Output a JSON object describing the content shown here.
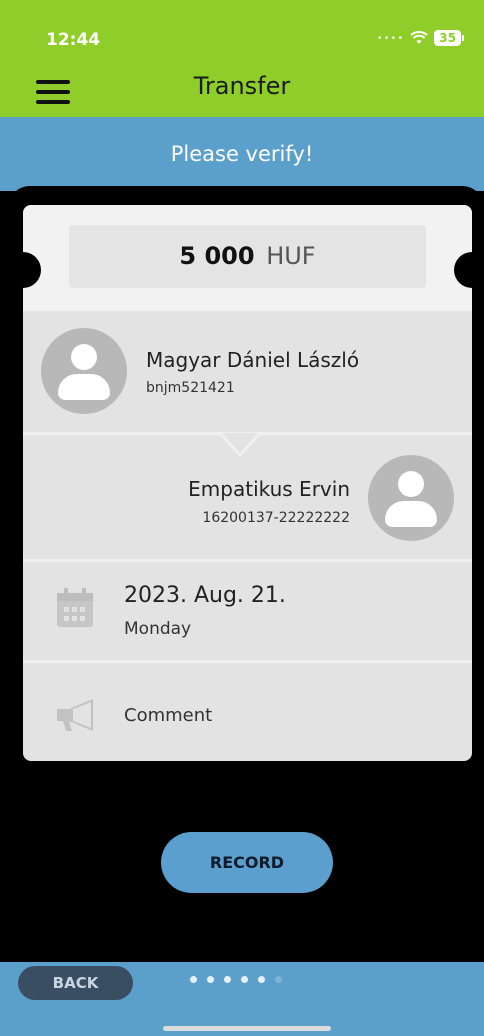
{
  "status": {
    "time": "12:44",
    "battery": "35"
  },
  "header": {
    "title": "Transfer"
  },
  "verify_banner": "Please verify!",
  "transfer": {
    "amount": "5 000",
    "currency": "HUF",
    "sender": {
      "name": "Magyar Dániel László",
      "id": "bnjm521421"
    },
    "recipient": {
      "name": "Empatikus Ervin",
      "account": "16200137-22222222"
    },
    "date": "2023. Aug. 21.",
    "weekday": "Monday",
    "comment_label": "Comment"
  },
  "actions": {
    "record": "RECORD",
    "back": "BACK"
  },
  "pager": {
    "total": 6,
    "current": 5
  },
  "colors": {
    "header_green": "#8fce2a",
    "accent_blue": "#5b9fcb"
  },
  "icons": [
    "menu-icon",
    "wifi-icon",
    "battery-icon",
    "user-avatar-icon",
    "calendar-icon",
    "megaphone-icon"
  ]
}
